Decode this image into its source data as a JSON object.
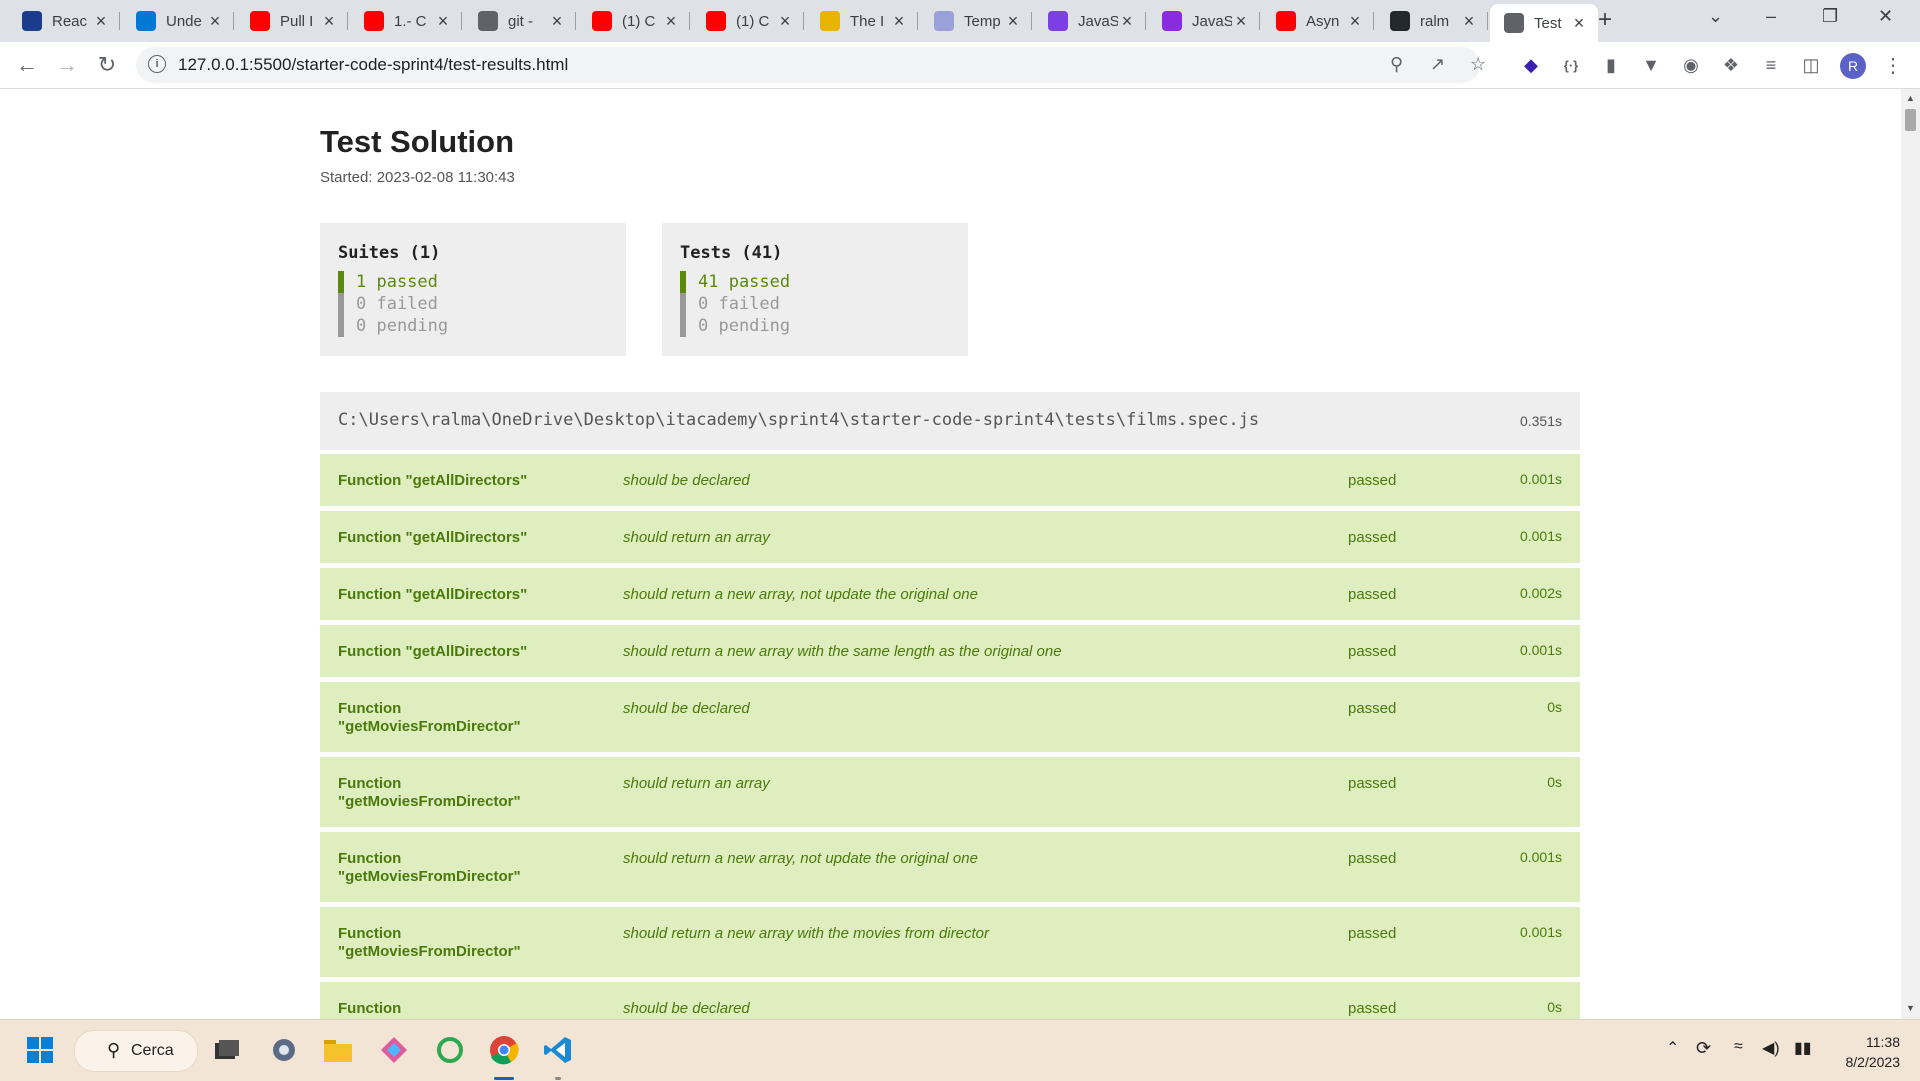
{
  "browser": {
    "tabs": [
      {
        "title": "Reac",
        "icon": "react-icon",
        "color": "#1a3c8a"
      },
      {
        "title": "Unde",
        "icon": "azure-icon",
        "color": "#0078d4"
      },
      {
        "title": "Pull I",
        "icon": "youtube-icon",
        "color": "#ff0000"
      },
      {
        "title": "1.- C",
        "icon": "youtube-icon",
        "color": "#ff0000"
      },
      {
        "title": "git -",
        "icon": "globe-icon",
        "color": "#5f6368"
      },
      {
        "title": "(1) C",
        "icon": "youtube-icon",
        "color": "#ff0000"
      },
      {
        "title": "(1) C",
        "icon": "youtube-icon",
        "color": "#ff0000"
      },
      {
        "title": "The I",
        "icon": "character-icon",
        "color": "#e8b400"
      },
      {
        "title": "Temp",
        "icon": "page-icon",
        "color": "#9aa0d8"
      },
      {
        "title": "JavaS",
        "icon": "braces-icon",
        "color": "#7b3fe4"
      },
      {
        "title": "JavaS",
        "icon": "info-icon",
        "color": "#8a2be2"
      },
      {
        "title": "Asyn",
        "icon": "youtube-icon",
        "color": "#ff0000"
      },
      {
        "title": "ralm",
        "icon": "github-icon",
        "color": "#24292f"
      },
      {
        "title": "Test",
        "icon": "globe-icon",
        "color": "#5f6368",
        "active": true
      }
    ],
    "url": "127.0.0.1:5500/starter-code-sprint4/test-results.html",
    "profile_initial": "R"
  },
  "report": {
    "title": "Test Solution",
    "started": "Started: 2023-02-08 11:30:43",
    "suites": {
      "heading": "Suites (1)",
      "passed": "1 passed",
      "failed": "0 failed",
      "pending": "0 pending"
    },
    "tests": {
      "heading": "Tests (41)",
      "passed": "41 passed",
      "failed": "0 failed",
      "pending": "0 pending"
    },
    "file": {
      "path": "C:\\Users\\ralma\\OneDrive\\Desktop\\itacademy\\sprint4\\starter-code-sprint4\\tests\\films.spec.js",
      "time": "0.351s"
    },
    "rows": [
      {
        "suite": "Function \"getAllDirectors\"",
        "desc": "should be declared",
        "status": "passed",
        "time": "0.001s"
      },
      {
        "suite": "Function \"getAllDirectors\"",
        "desc": "should return an array",
        "status": "passed",
        "time": "0.001s"
      },
      {
        "suite": "Function \"getAllDirectors\"",
        "desc": "should return a new array, not update the original one",
        "status": "passed",
        "time": "0.002s"
      },
      {
        "suite": "Function \"getAllDirectors\"",
        "desc": "should return a new array with the same length as the original one",
        "status": "passed",
        "time": "0.001s"
      },
      {
        "suite": "Function \"getMoviesFromDirector\"",
        "desc": "should be declared",
        "status": "passed",
        "time": "0s"
      },
      {
        "suite": "Function \"getMoviesFromDirector\"",
        "desc": "should return an array",
        "status": "passed",
        "time": "0s"
      },
      {
        "suite": "Function \"getMoviesFromDirector\"",
        "desc": "should return a new array, not update the original one",
        "status": "passed",
        "time": "0.001s"
      },
      {
        "suite": "Function \"getMoviesFromDirector\"",
        "desc": "should return a new array with the movies from director",
        "status": "passed",
        "time": "0.001s"
      },
      {
        "suite": "Function",
        "desc": "should be declared",
        "status": "passed",
        "time": "0s"
      }
    ]
  },
  "taskbar": {
    "search_label": "Cerca",
    "time": "11:38",
    "date": "8/2/2023"
  }
}
